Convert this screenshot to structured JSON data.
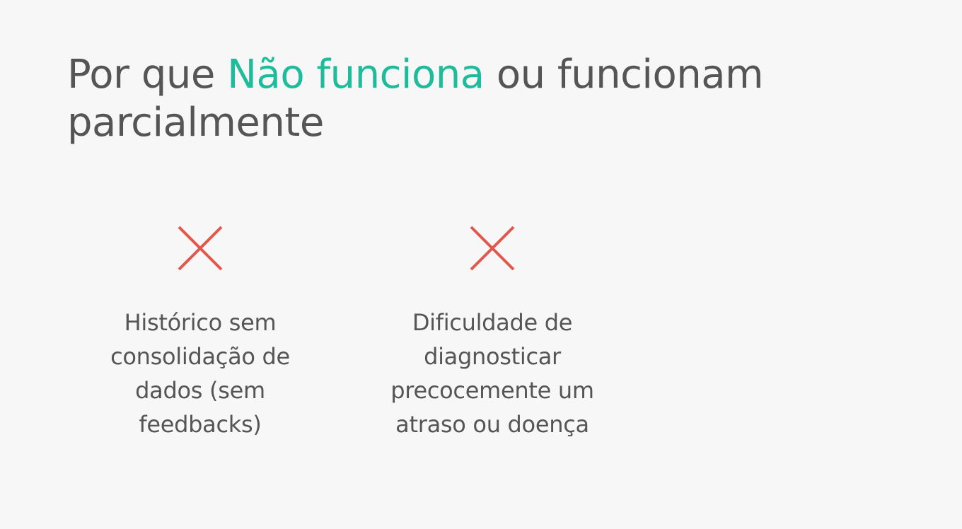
{
  "title": {
    "prefix": "Por que ",
    "accent": "Não funciona",
    "suffix": " ou funcionam",
    "line2": "parcialmente"
  },
  "cards": [
    {
      "icon": "x-icon",
      "lines": [
        "Histórico sem",
        "consolidação de",
        "dados (sem",
        "feedbacks)"
      ]
    },
    {
      "icon": "x-icon",
      "lines": [
        "Dificuldade de",
        "diagnosticar",
        "precocemente um",
        "atraso ou doença"
      ]
    }
  ],
  "colors": {
    "background": "#f7f7f7",
    "text": "#555555",
    "accent": "#1fbc9c",
    "icon": "#e2574c"
  }
}
